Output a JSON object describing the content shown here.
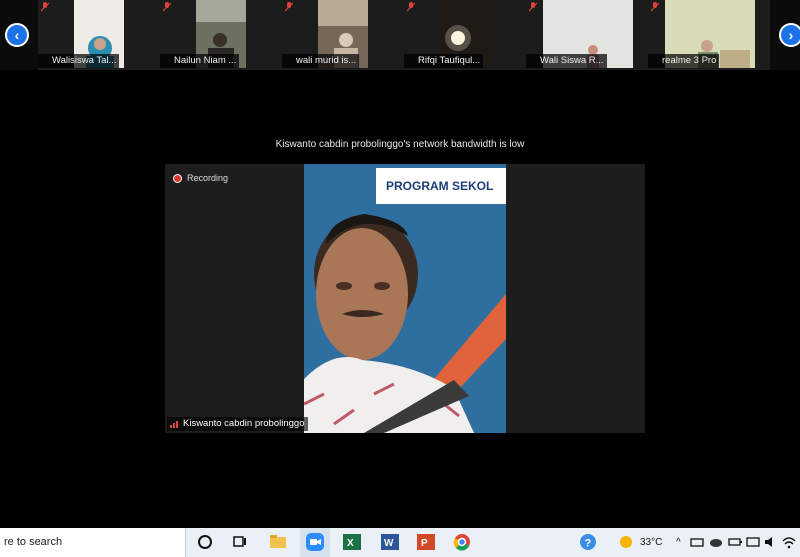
{
  "participants": [
    {
      "name": "Walisiswa Tal...",
      "thumb": "#ece9e4"
    },
    {
      "name": "Nailun Niam ...",
      "thumb": "#6f7160"
    },
    {
      "name": "wali murid is...",
      "thumb": "#7a6c5e"
    },
    {
      "name": "Rifqi Taufiqul...",
      "thumb": "#221d17"
    },
    {
      "name": "Wali Siswa R...",
      "thumb": "#e2e2de"
    },
    {
      "name": "realme 3 Pro",
      "thumb": "#d7dcb6"
    }
  ],
  "nav": {
    "prev_icon": "chevron-left-icon",
    "next_icon": "chevron-right-icon"
  },
  "bandwidth_notice": "Kiswanto cabdin probolinggo's network bandwidth is low",
  "speaker": {
    "recording_label": "Recording",
    "name": "Kiswanto cabdin probolinggo",
    "banner_text": "PROGRAM SEKOL"
  },
  "taskbar": {
    "search_text": "re to search",
    "apps": [
      "task-view-icon",
      "file-explorer-icon",
      "zoom-icon",
      "excel-icon",
      "word-icon",
      "powerpoint-icon",
      "chrome-icon"
    ],
    "temperature": "33°C"
  },
  "colors": {
    "accent": "#1a73e8",
    "recording": "#d93b30",
    "banner_text": "#1d3f7a",
    "bg_blue": "#2f6fa0"
  }
}
